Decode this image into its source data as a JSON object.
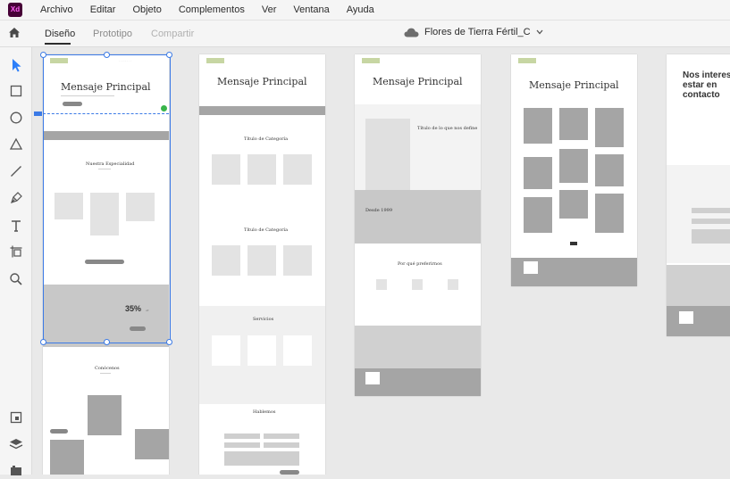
{
  "app": {
    "logo_text": "Xd",
    "accent": "#3b7ae6",
    "logo_color": "#470137"
  },
  "menubar": {
    "items": [
      "Archivo",
      "Editar",
      "Objeto",
      "Complementos",
      "Ver",
      "Ventana",
      "Ayuda"
    ]
  },
  "toolbar": {
    "tabs": {
      "design": "Diseño",
      "prototype": "Prototipo",
      "share": "Compartir"
    },
    "document_title": "Flores de Tierra Fértil_C",
    "cloud_icon": "cloud-icon",
    "home_icon": "home-icon"
  },
  "tools": [
    "select-arrow-icon",
    "rectangle-tool-icon",
    "ellipse-tool-icon",
    "polygon-tool-icon",
    "line-tool-icon",
    "pen-tool-icon",
    "text-tool-icon",
    "artboard-tool-icon",
    "zoom-tool-icon",
    "plugins-icon",
    "layers-icon",
    "assets-icon"
  ],
  "artboards": [
    {
      "heading": "Mensaje Principal",
      "section1": "Nuestra Especialidad",
      "discount": "35%",
      "discount_suffix": "off",
      "section2": "Conócenos"
    },
    {
      "heading": "Mensaje Principal",
      "section1": "Título de Categoría",
      "section2": "Título de Categoría",
      "section3": "Servicios",
      "section4": "Hablemos"
    },
    {
      "heading": "Mensaje Principal",
      "section1": "Título de lo que nos define",
      "section2": "Desde 1999",
      "section3": "Por qué preferirnos"
    },
    {
      "heading": "Mensaje Principal"
    },
    {
      "heading": "Nos interesa estar en contacto"
    }
  ]
}
